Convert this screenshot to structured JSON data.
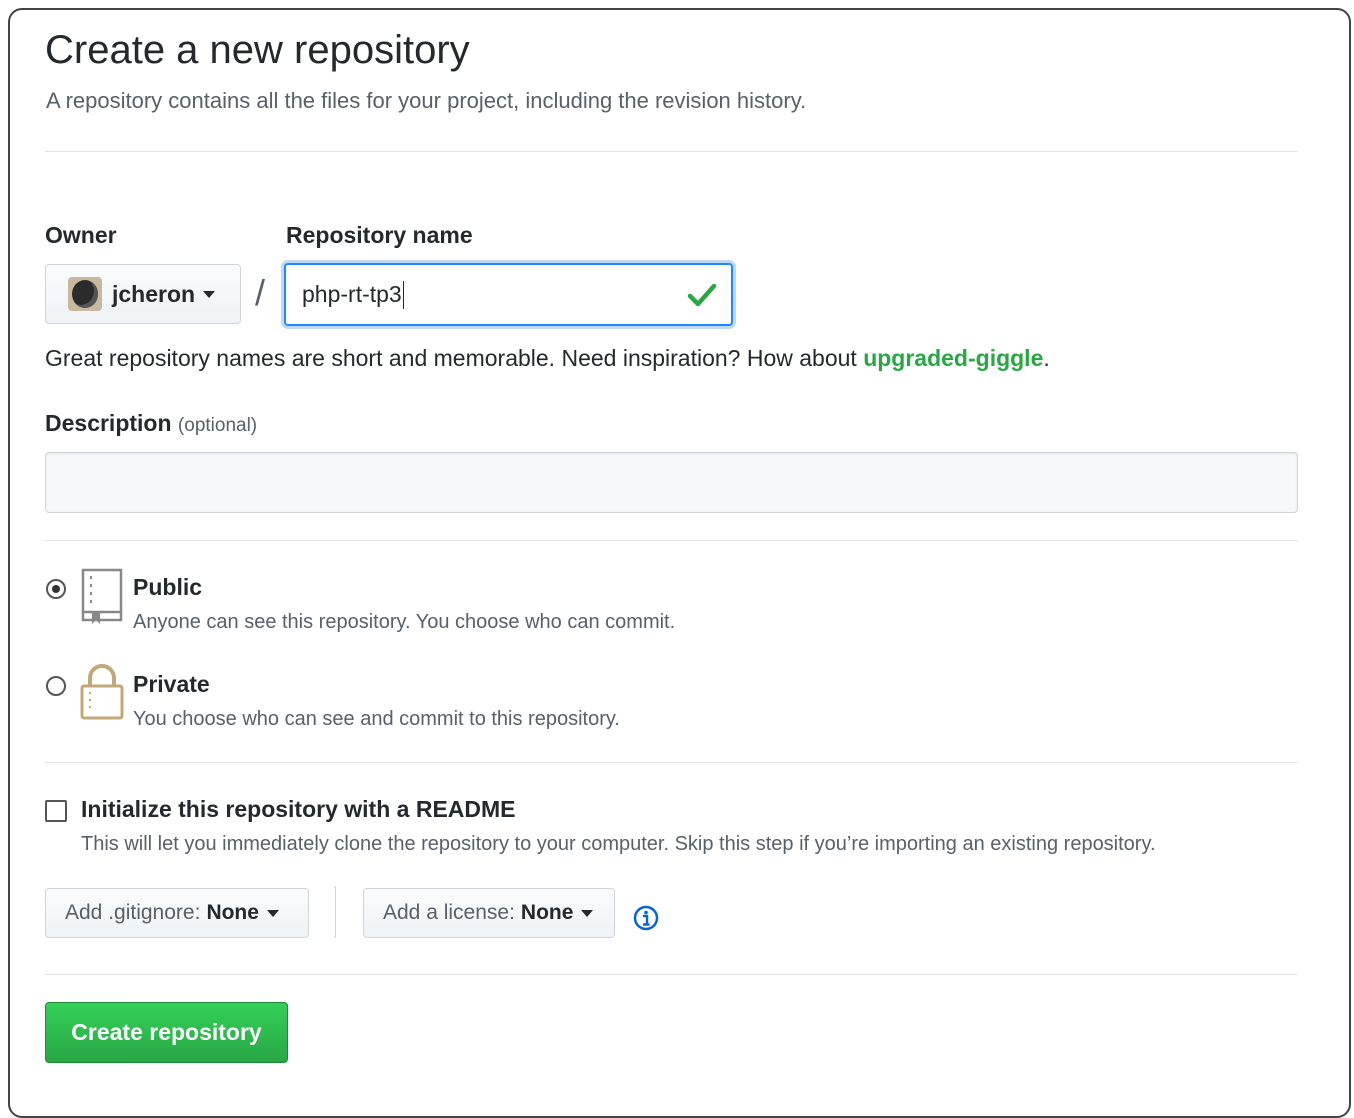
{
  "header": {
    "title": "Create a new repository",
    "subtitle": "A repository contains all the files for your project, including the revision history."
  },
  "owner": {
    "label": "Owner",
    "name": "jcheron"
  },
  "repo": {
    "label": "Repository name",
    "value": "php-rt-tp3",
    "separator": "/",
    "hint": "Great repository names are short and memorable. Need inspiration? How about ",
    "suggestion": "upgraded-giggle",
    "hint_end": "."
  },
  "description": {
    "label": "Description",
    "optional": "(optional)",
    "value": ""
  },
  "visibility": {
    "public": {
      "title": "Public",
      "desc": "Anyone can see this repository. You choose who can commit.",
      "checked": true
    },
    "private": {
      "title": "Private",
      "desc": "You choose who can see and commit to this repository.",
      "checked": false
    }
  },
  "readme": {
    "label": "Initialize this repository with a README",
    "desc": "This will let you immediately clone the repository to your computer. Skip this step if you’re importing an existing repository.",
    "checked": false
  },
  "gitignore": {
    "label": "Add .gitignore:",
    "value": "None"
  },
  "license": {
    "label": "Add a license:",
    "value": "None"
  },
  "submit": {
    "label": "Create repository"
  },
  "colors": {
    "accent_green": "#28a745",
    "focus_blue": "#2188ff",
    "info_blue": "#0366d6"
  },
  "icons": [
    "repo-icon",
    "lock-icon",
    "check-icon",
    "info-icon",
    "caret-down-icon"
  ]
}
